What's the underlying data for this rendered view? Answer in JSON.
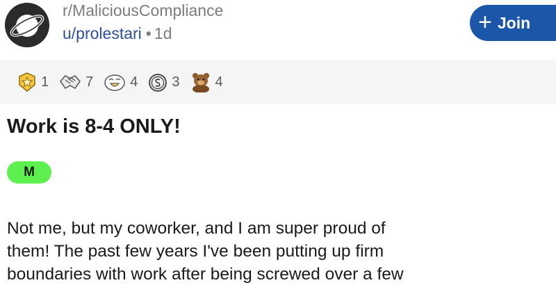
{
  "post": {
    "subreddit": "r/MaliciousCompliance",
    "author": "u/prolestari",
    "separator": "•",
    "age": "1d",
    "title": "Work is 8-4 ONLY!",
    "flair": "M",
    "body_lines": [
      "Not me, but my coworker, and I am super proud of",
      "them! The past few years I've been putting up firm",
      "boundaries with work after being screwed over a few"
    ]
  },
  "join_button": {
    "plus": "+",
    "label": "Join"
  },
  "awards": [
    {
      "icon": "star-badge-icon",
      "count": "1"
    },
    {
      "icon": "handshake-icon",
      "count": "7"
    },
    {
      "icon": "laughing-face-icon",
      "count": "4"
    },
    {
      "icon": "coin-icon",
      "count": "3"
    },
    {
      "icon": "bear-icon",
      "count": "4"
    }
  ],
  "colors": {
    "join_button": "#1c56a9",
    "user_link": "#2d4f9c",
    "flair": "#5ef04e",
    "awards_bar": "#f5f5f5"
  }
}
